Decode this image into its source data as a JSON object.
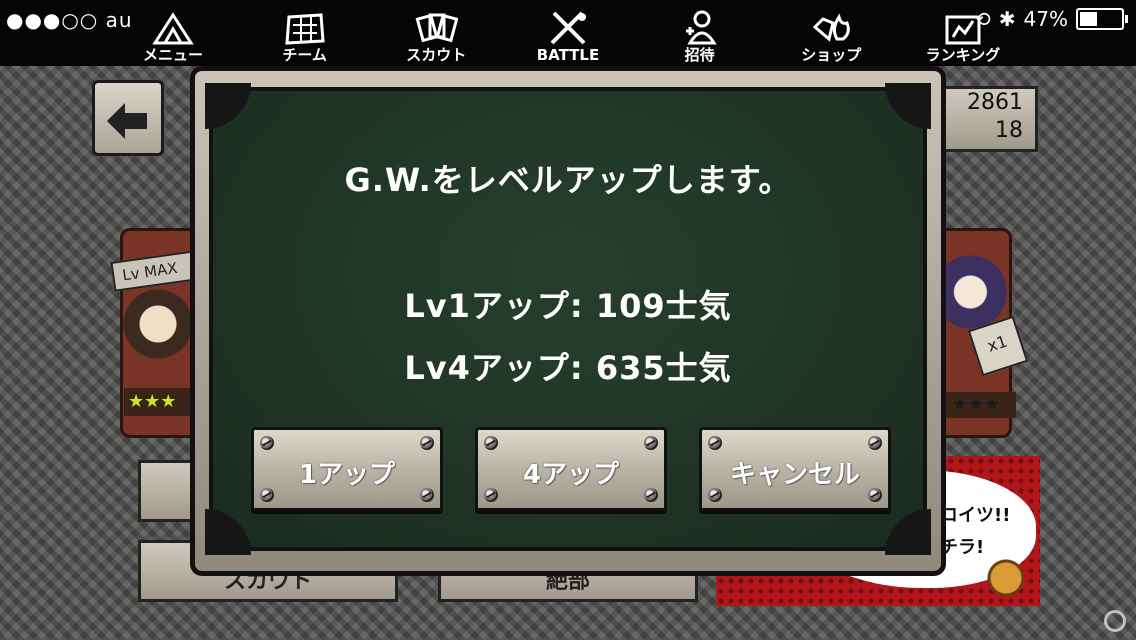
{
  "status_bar": {
    "signal": "●●●○○ au",
    "battery_percent": "47%",
    "battery_level": 0.47
  },
  "nav": [
    {
      "label": "メニュー",
      "icon": "tent-icon"
    },
    {
      "label": "チーム",
      "icon": "map-icon"
    },
    {
      "label": "スカウト",
      "icon": "cards-icon"
    },
    {
      "label": "BATTLE",
      "icon": "crossed-weapons-icon"
    },
    {
      "label": "招待",
      "icon": "invite-icon"
    },
    {
      "label": "ショップ",
      "icon": "gem-fire-icon"
    },
    {
      "label": "ランキング",
      "icon": "ranking-icon"
    }
  ],
  "background": {
    "stat_top": "2861",
    "stat_bottom": "18",
    "lv_badge": "Lv MAX",
    "x_count": "x1",
    "stars_left": "★★★",
    "stars_right": "★★★",
    "btn_left_label": "スカウト",
    "btn_mid_label": "絶部",
    "speech_line1": "コイツ!!",
    "speech_line2": "チラ!"
  },
  "modal": {
    "title": "G.W.をレベルアップします。",
    "cost_line1": "Lv1アップ: 109士気",
    "cost_line2": "Lv4アップ: 635士気",
    "btn_1up": "1アップ",
    "btn_4up": "4アップ",
    "btn_cancel": "キャンセル"
  },
  "colors": {
    "board": "#1f3425",
    "frame": "#c9c4b6",
    "card": "#7a3426",
    "speech_bg": "#b3161a"
  }
}
